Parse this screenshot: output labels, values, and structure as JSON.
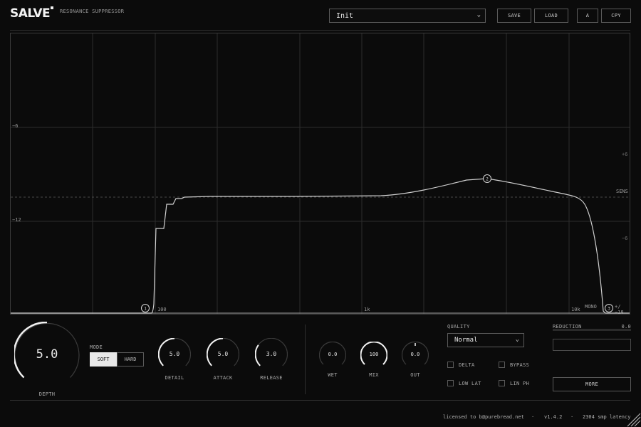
{
  "header": {
    "logo": "SALVE",
    "subtitle": "RESONANCE SUPPRESSOR",
    "preset": "Init",
    "save_label": "SAVE",
    "load_label": "LOAD",
    "ab_label": "A",
    "copy_label": "CPY"
  },
  "graph": {
    "y_labels_left": [
      "−6",
      "−12"
    ],
    "y_labels_right": [
      "+6",
      "−6"
    ],
    "sens_label": "SENS",
    "x_labels": [
      "100",
      "1k",
      "10k"
    ],
    "mono_label": "MONO",
    "range_label": "+/−18",
    "node_labels": [
      "1",
      "2",
      "3"
    ]
  },
  "controls": {
    "depth": {
      "label": "DEPTH",
      "value": "5.0",
      "fraction": 0.5
    },
    "mode": {
      "label": "MODE",
      "options": [
        "SOFT",
        "HARD"
      ],
      "selected": "SOFT"
    },
    "detail": {
      "label": "DETAIL",
      "value": "5.0",
      "fraction": 0.5
    },
    "attack": {
      "label": "ATTACK",
      "value": "5.0",
      "fraction": 0.5
    },
    "release": {
      "label": "RELEASE",
      "value": "3.0",
      "fraction": 0.3
    },
    "wet": {
      "label": "WET",
      "value": "0.0",
      "fraction": 0.0
    },
    "mix": {
      "label": "MIX",
      "value": "100",
      "fraction": 1.0
    },
    "out": {
      "label": "OUT",
      "value": "0.0",
      "fraction": 0.5
    }
  },
  "quality": {
    "label": "QUALITY",
    "selected": "Normal",
    "options": [
      {
        "label": "DELTA",
        "checked": false
      },
      {
        "label": "BYPASS",
        "checked": false
      },
      {
        "label": "LOW LAT",
        "checked": false
      },
      {
        "label": "LIN PH",
        "checked": false
      }
    ]
  },
  "reduction": {
    "label": "REDUCTION",
    "value": "0.0",
    "fraction": 0.0
  },
  "more_label": "MORE",
  "footer": {
    "license": "licensed to b@purebread.net",
    "sep": "·",
    "version": "v1.4.2",
    "latency": "2304 smp latency"
  },
  "colors": {
    "background": "#0b0b0b",
    "curve": "#cfcfcf",
    "accent": "#f2f2f2"
  }
}
